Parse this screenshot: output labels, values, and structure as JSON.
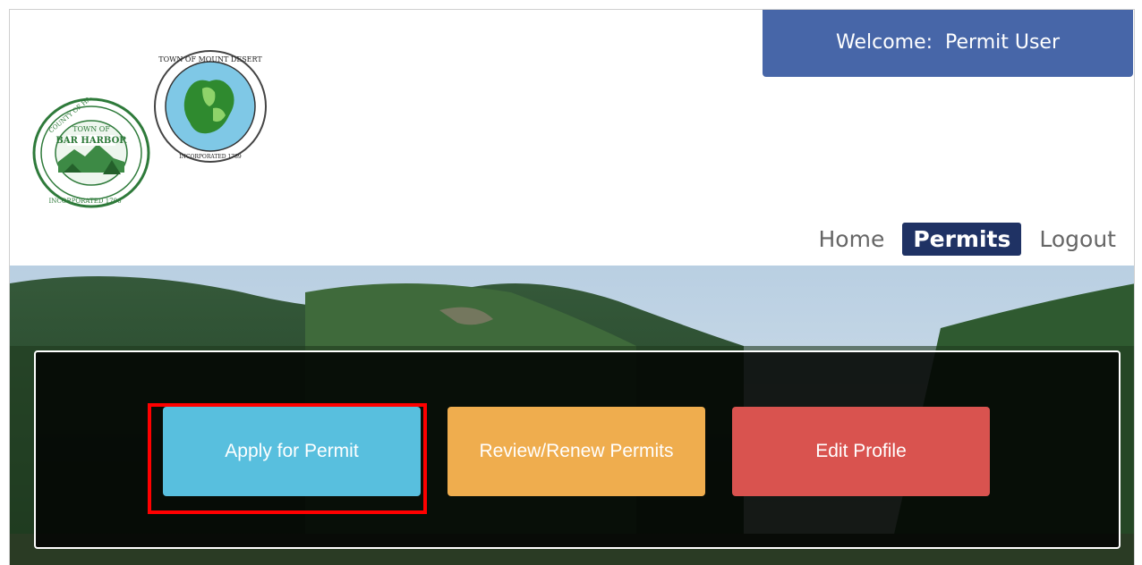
{
  "header": {
    "welcome_text": "Welcome:  Permit User",
    "logos": [
      {
        "name": "Town of Bar Harbor seal",
        "text": "TOWN OF BAR HARBOR"
      },
      {
        "name": "Town of Mount Desert seal",
        "text": "TOWN OF MOUNT DESERT"
      }
    ]
  },
  "nav": {
    "items": [
      {
        "label": "Home",
        "active": false
      },
      {
        "label": "Permits",
        "active": true
      },
      {
        "label": "Logout",
        "active": false
      }
    ]
  },
  "actions": {
    "apply_label": "Apply for Permit",
    "review_label": "Review/Renew Permits",
    "edit_label": "Edit Profile"
  },
  "colors": {
    "welcome_bg": "#4766a8",
    "nav_active_bg": "#1f3264",
    "apply_bg": "#58bfde",
    "review_bg": "#efad4e",
    "edit_bg": "#d9534f",
    "highlight": "#ff0000"
  }
}
